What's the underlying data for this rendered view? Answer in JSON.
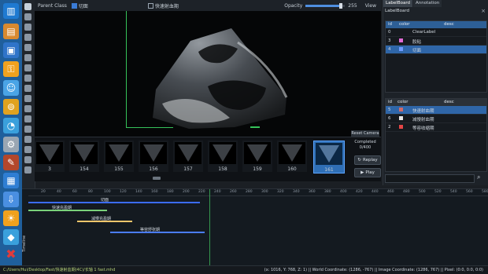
{
  "dock": {
    "icons": [
      "book-icon",
      "folder-icon",
      "save-icon",
      "lock-icon",
      "person-icon",
      "network-icon",
      "browser-icon",
      "gear-icon",
      "tools-icon",
      "document-icon",
      "download-icon",
      "brightness-icon",
      "diamond-icon",
      "close-icon"
    ]
  },
  "topbar": {
    "parent_class_label": "Parent Class",
    "class_1": "切面",
    "class_2": "快速射血期",
    "opacity_label": "Opacity",
    "opacity_value": "255",
    "opacity_fraction": 0.9,
    "view_label": "View"
  },
  "thumbnails": [
    {
      "num": "3"
    },
    {
      "num": "154"
    },
    {
      "num": "155"
    },
    {
      "num": "156"
    },
    {
      "num": "157"
    },
    {
      "num": "158"
    },
    {
      "num": "159"
    },
    {
      "num": "160"
    },
    {
      "num": "161",
      "selected": true
    }
  ],
  "controls": {
    "reset_camera": "Reset Camera",
    "completed_label": "Completed",
    "completed_value": "0/400",
    "replay": "Replay",
    "play": "Play"
  },
  "right_panel": {
    "tabs": [
      "LabelBoard",
      "Annotation"
    ],
    "title": "LabelBoard",
    "close": "×",
    "table1": {
      "headers": [
        "id",
        "color",
        "desc"
      ],
      "rows": [
        {
          "id": "0",
          "color": "",
          "desc": "ClearLabel"
        },
        {
          "id": "3",
          "color": "#e06bd6",
          "desc": "胶粘"
        },
        {
          "id": "4",
          "color": "#6f9cff",
          "desc": "切面",
          "selected": true
        }
      ]
    },
    "table2": {
      "headers": [
        "id",
        "color",
        "desc"
      ],
      "rows": [
        {
          "id": "5",
          "color": "#d06a6a",
          "desc": "快速射血期",
          "selected": true
        },
        {
          "id": "6",
          "color": "#e6e6e6",
          "desc": "减慢射血期"
        },
        {
          "id": "2",
          "color": "#e44646",
          "desc": "等容收缩期"
        }
      ]
    }
  },
  "timeline": {
    "label": "Timeline",
    "ticks": [
      "20",
      "40",
      "60",
      "80",
      "100",
      "120",
      "140",
      "160",
      "180",
      "200",
      "220",
      "240",
      "260",
      "280",
      "300",
      "320",
      "340",
      "360",
      "380",
      "400",
      "420",
      "440",
      "460",
      "480",
      "500",
      "520",
      "540",
      "560",
      "580"
    ],
    "tracks": [
      {
        "label": "切面",
        "color": "#3b6cff"
      },
      {
        "label": "快速充盈期",
        "color": "#7ad27a"
      },
      {
        "label": "减慢充盈期",
        "color": "#f2c66b"
      },
      {
        "label": "等容舒张期",
        "color": "#4a7cff"
      }
    ]
  },
  "status": {
    "path": "C:/Users/Hui/Desktop/Fast/快速射血期(4C)/长轴 1 fast.mhd",
    "coords": "(x: 1016, Y: 768, Z: 1) || World Coordinate: (1286, -767) || Image Coordinate: (1286, 767) || Pixel: (0:0, 0:0, 0:0)"
  }
}
